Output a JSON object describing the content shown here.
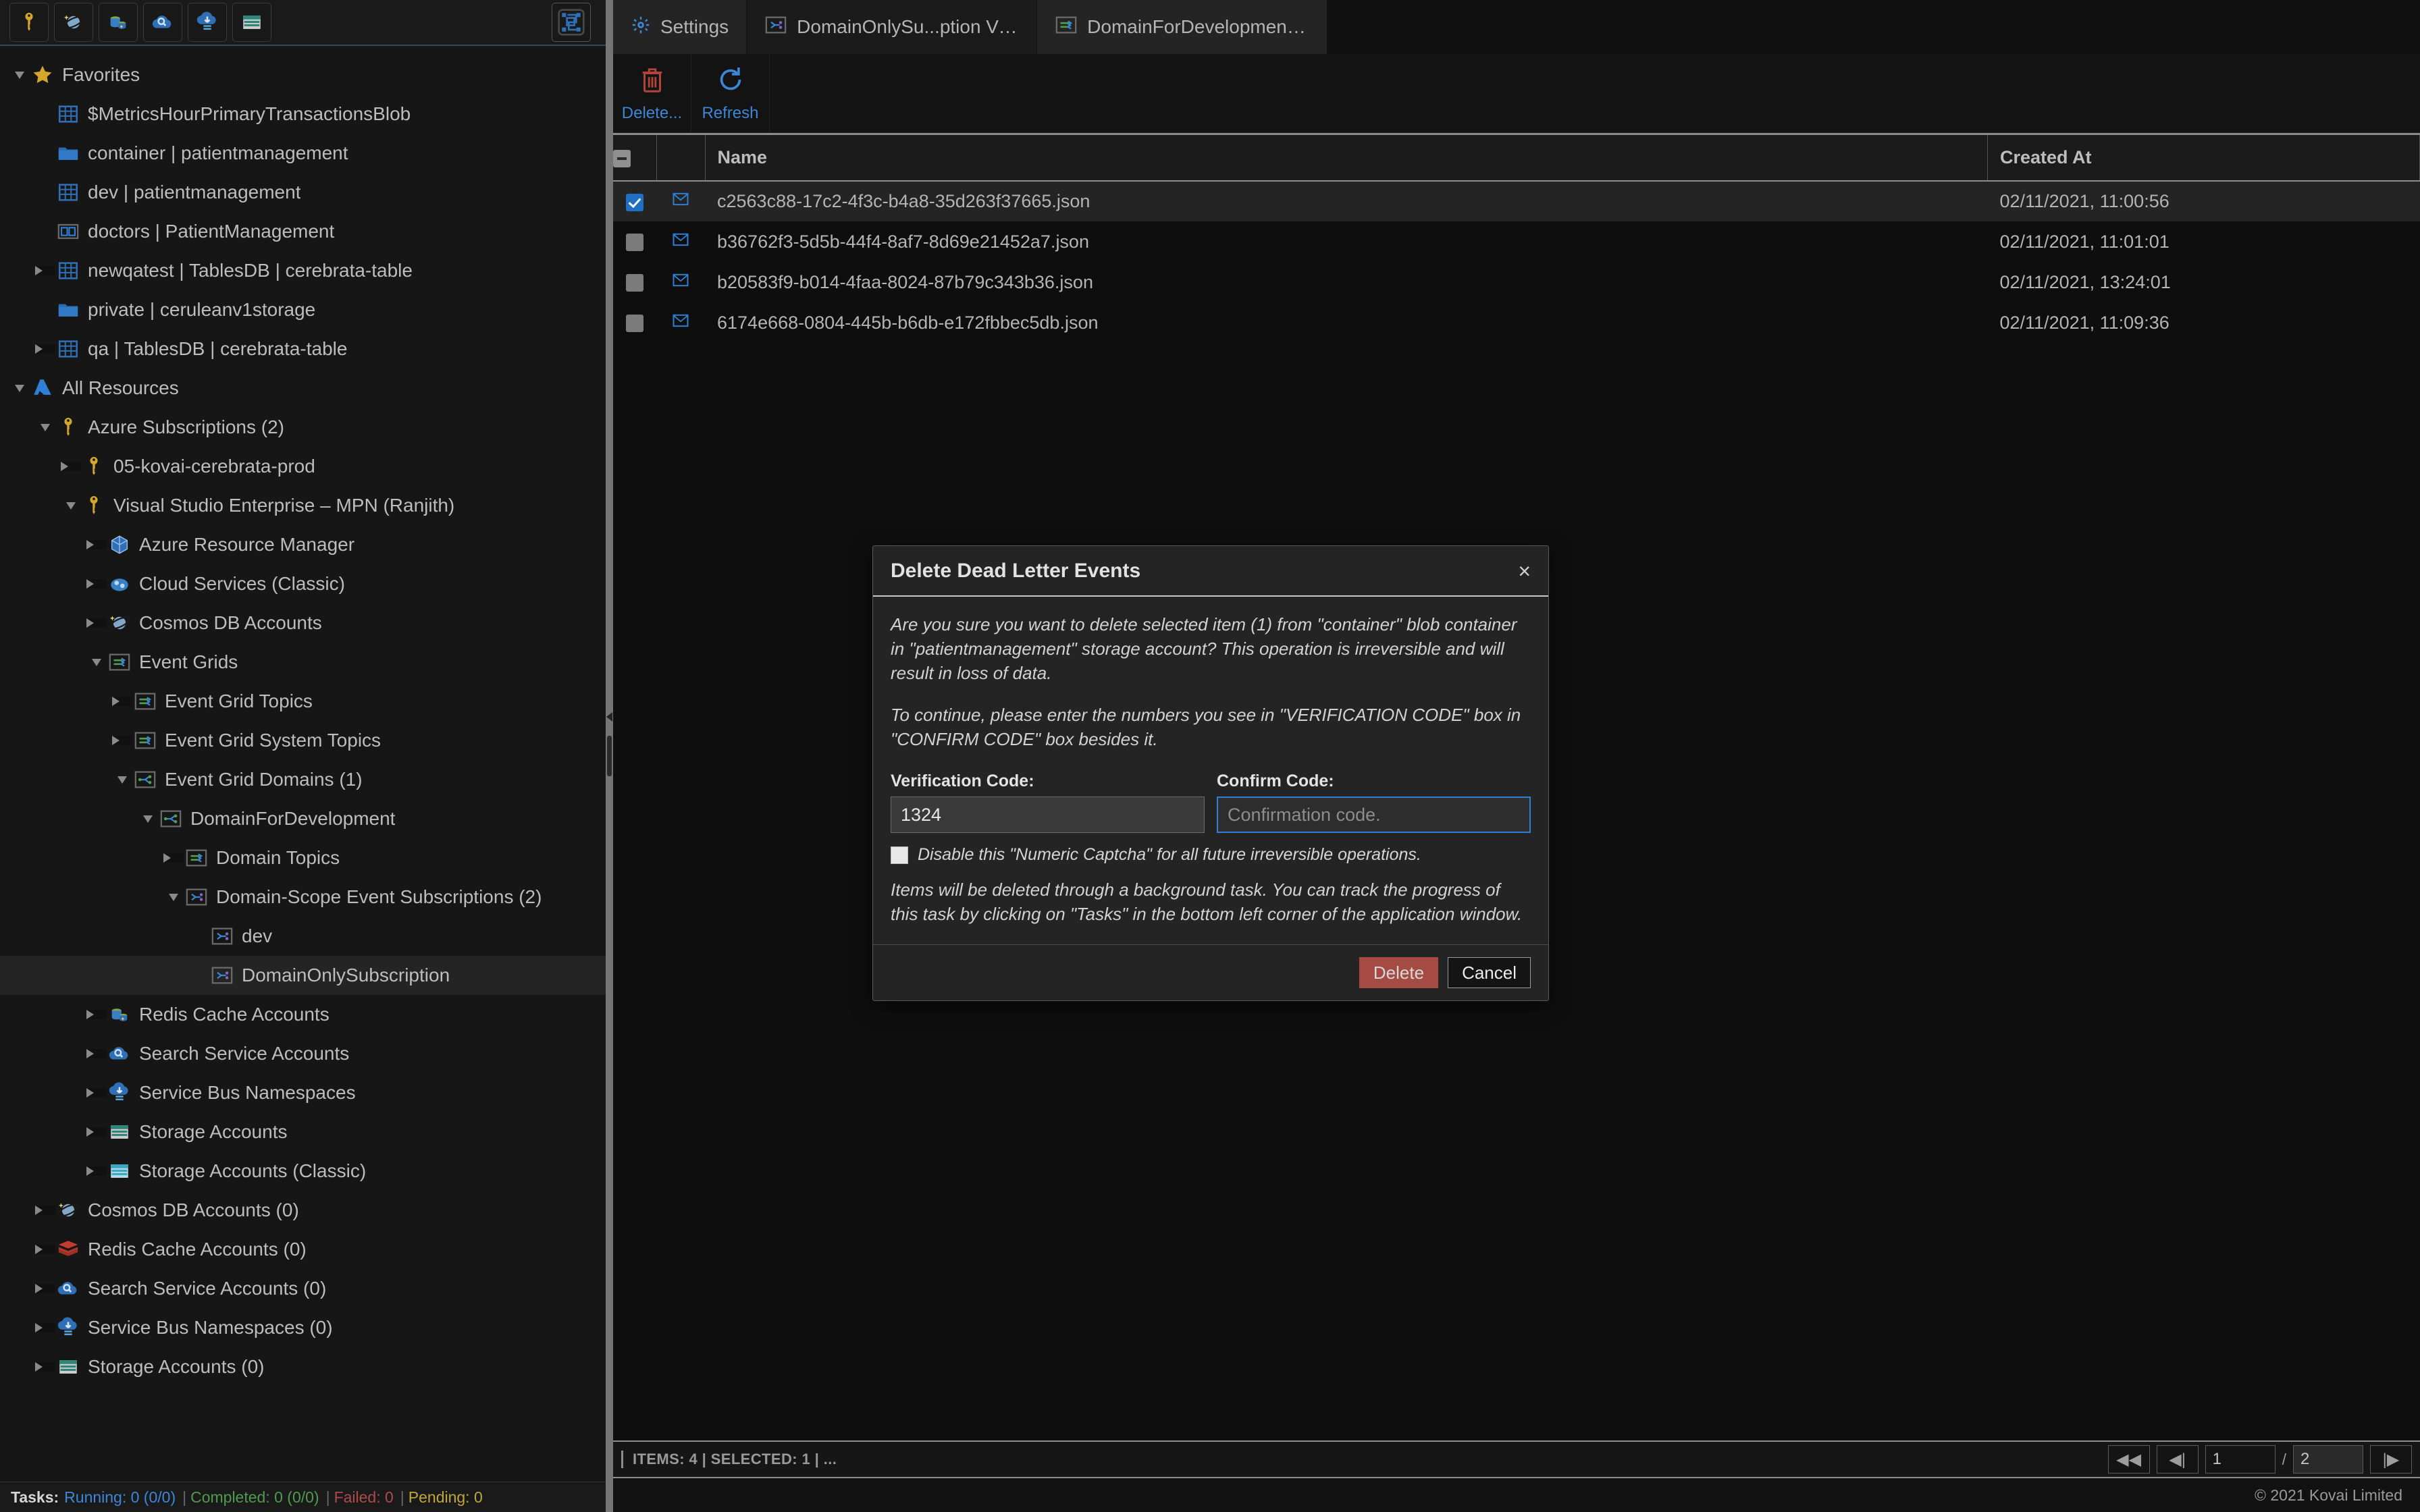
{
  "left_toolbar": {
    "icons": [
      {
        "name": "key-icon",
        "label": "Azure Subscriptions"
      },
      {
        "name": "cosmos-db-icon",
        "label": "Cosmos DB Accounts"
      },
      {
        "name": "redis-cache-icon",
        "label": "Redis Cache Accounts"
      },
      {
        "name": "search-service-icon",
        "label": "Search Service Accounts"
      },
      {
        "name": "service-bus-icon",
        "label": "Service Bus Namespaces"
      },
      {
        "name": "storage-account-icon",
        "label": "Storage Accounts"
      }
    ],
    "right_icon": {
      "name": "collapse-all-icon",
      "label": "Collapse All"
    }
  },
  "tree": [
    {
      "label": "Favorites",
      "depth": 0,
      "twisty": "down",
      "icon": "star-icon",
      "selected": false
    },
    {
      "label": "$MetricsHourPrimaryTransactionsBlob",
      "depth": 1,
      "twisty": "none",
      "icon": "table-icon",
      "selected": false
    },
    {
      "label": "container | patientmanagement",
      "depth": 1,
      "twisty": "none",
      "icon": "folder-icon",
      "selected": false
    },
    {
      "label": "dev | patientmanagement",
      "depth": 1,
      "twisty": "none",
      "icon": "table-icon",
      "selected": false
    },
    {
      "label": "doctors | PatientManagement",
      "depth": 1,
      "twisty": "none",
      "icon": "queue-icon",
      "selected": false
    },
    {
      "label": "newqatest | TablesDB | cerebrata-table",
      "depth": 1,
      "twisty": "right",
      "icon": "table-icon",
      "selected": false
    },
    {
      "label": "private | ceruleanv1storage",
      "depth": 1,
      "twisty": "none",
      "icon": "folder-icon",
      "selected": false
    },
    {
      "label": "qa | TablesDB | cerebrata-table",
      "depth": 1,
      "twisty": "right",
      "icon": "table-icon",
      "selected": false
    },
    {
      "label": "All Resources",
      "depth": 0,
      "twisty": "down",
      "icon": "azure-icon",
      "selected": false
    },
    {
      "label": "Azure Subscriptions (2)",
      "depth": 1,
      "twisty": "down",
      "icon": "key-icon",
      "selected": false
    },
    {
      "label": "05-kovai-cerebrata-prod",
      "depth": 2,
      "twisty": "right",
      "icon": "key-icon",
      "selected": false
    },
    {
      "label": "Visual Studio Enterprise – MPN (Ranjith)",
      "depth": 2,
      "twisty": "down",
      "icon": "key-icon",
      "selected": false
    },
    {
      "label": "Azure Resource Manager",
      "depth": 3,
      "twisty": "right",
      "icon": "resource-manager-icon",
      "selected": false
    },
    {
      "label": "Cloud Services (Classic)",
      "depth": 3,
      "twisty": "right",
      "icon": "cloud-services-icon",
      "selected": false
    },
    {
      "label": "Cosmos DB Accounts",
      "depth": 3,
      "twisty": "right",
      "icon": "cosmos-db-icon",
      "selected": false
    },
    {
      "label": "Event Grids",
      "depth": 3,
      "twisty": "down",
      "icon": "event-grid-icon",
      "selected": false
    },
    {
      "label": "Event Grid Topics",
      "depth": 4,
      "twisty": "right",
      "icon": "event-grid-icon",
      "selected": false
    },
    {
      "label": "Event Grid System Topics",
      "depth": 4,
      "twisty": "right",
      "icon": "event-grid-icon",
      "selected": false
    },
    {
      "label": "Event Grid Domains (1)",
      "depth": 4,
      "twisty": "down",
      "icon": "event-grid-domain-icon",
      "selected": false
    },
    {
      "label": "DomainForDevelopment",
      "depth": 5,
      "twisty": "down",
      "icon": "event-grid-domain-icon",
      "selected": false
    },
    {
      "label": "Domain Topics",
      "depth": 6,
      "twisty": "right",
      "icon": "event-grid-icon",
      "selected": false
    },
    {
      "label": "Domain-Scope Event Subscriptions (2)",
      "depth": 6,
      "twisty": "down",
      "icon": "event-subscription-icon",
      "selected": false
    },
    {
      "label": "dev",
      "depth": 7,
      "twisty": "none",
      "icon": "event-subscription-icon",
      "selected": false
    },
    {
      "label": "DomainOnlySubscription",
      "depth": 7,
      "twisty": "none",
      "icon": "event-subscription-icon",
      "selected": true
    },
    {
      "label": "Redis Cache Accounts",
      "depth": 3,
      "twisty": "right",
      "icon": "redis-cache-icon",
      "selected": false
    },
    {
      "label": "Search Service Accounts",
      "depth": 3,
      "twisty": "right",
      "icon": "search-service-icon",
      "selected": false
    },
    {
      "label": "Service Bus Namespaces",
      "depth": 3,
      "twisty": "right",
      "icon": "service-bus-icon",
      "selected": false
    },
    {
      "label": "Storage Accounts",
      "depth": 3,
      "twisty": "right",
      "icon": "storage-account-icon",
      "selected": false
    },
    {
      "label": "Storage Accounts (Classic)",
      "depth": 3,
      "twisty": "right",
      "icon": "storage-classic-icon",
      "selected": false
    },
    {
      "label": "Cosmos DB Accounts (0)",
      "depth": 1,
      "twisty": "right",
      "icon": "cosmos-db-icon",
      "selected": false
    },
    {
      "label": "Redis Cache Accounts (0)",
      "depth": 1,
      "twisty": "right",
      "icon": "redis-stack-icon",
      "selected": false
    },
    {
      "label": "Search Service Accounts (0)",
      "depth": 1,
      "twisty": "right",
      "icon": "search-service-icon",
      "selected": false
    },
    {
      "label": "Service Bus Namespaces (0)",
      "depth": 1,
      "twisty": "right",
      "icon": "service-bus-icon",
      "selected": false
    },
    {
      "label": "Storage Accounts (0)",
      "depth": 1,
      "twisty": "right",
      "icon": "storage-account-icon",
      "selected": false
    }
  ],
  "tasks": {
    "prefix": "Tasks:",
    "running_label": "Running: 0 (0/0)",
    "completed_label": "Completed: 0 (0/0)",
    "failed_label": "Failed: 0",
    "pending_label": "Pending: 0",
    "separator": "|"
  },
  "tabs": [
    {
      "label": "Settings",
      "icon": "gear-icon",
      "active": false
    },
    {
      "label": "DomainOnlySu...ption Visu",
      "icon": "event-subscription-icon",
      "active": true
    },
    {
      "label": "DomainForDevelopment Vi",
      "icon": "event-grid-icon",
      "active": false
    }
  ],
  "commands": [
    {
      "label": "Delete...",
      "icon": "trash-icon"
    },
    {
      "label": "Refresh",
      "icon": "refresh-icon"
    }
  ],
  "grid": {
    "columns": [
      "",
      "",
      "Name",
      "Created At"
    ],
    "rows": [
      {
        "checked": true,
        "name": "c2563c88-17c2-4f3c-b4a8-35d263f37665.json",
        "created_at": "02/11/2021, 11:00:56"
      },
      {
        "checked": false,
        "name": "b36762f3-5d5b-44f4-8af7-8d69e21452a7.json",
        "created_at": "02/11/2021, 11:01:01"
      },
      {
        "checked": false,
        "name": "b20583f9-b014-4faa-8024-87b79c343b36.json",
        "created_at": "02/11/2021, 13:24:01"
      },
      {
        "checked": false,
        "name": "6174e668-0804-445b-b6db-e172fbbec5db.json",
        "created_at": "02/11/2021, 11:09:36"
      }
    ]
  },
  "statusbar": {
    "summary": "ITEMS: 4 | SELECTED: 1 |  ...",
    "pager": {
      "first_label": "◀◀",
      "prev_label": "◀|",
      "page": "1",
      "slash": "/",
      "total_pages": "2",
      "last_label": "|▶"
    }
  },
  "copyright": "© 2021 Kovai Limited",
  "dialog": {
    "title": "Delete Dead Letter Events",
    "close_label": "×",
    "paragraph1": "Are you sure you want to delete selected item (1) from \"container\" blob container in \"patientmanagement\" storage account? This operation is irreversible and will result in loss of data.",
    "paragraph2": "To continue, please enter the numbers you see in \"VERIFICATION CODE\" box in \"CONFIRM CODE\" box besides it.",
    "verification_label": "Verification Code:",
    "verification_value": "1324",
    "confirm_label": "Confirm Code:",
    "confirm_placeholder": "Confirmation code.",
    "confirm_value": "",
    "checkbox_label": "Disable this \"Numeric Captcha\" for all future irreversible operations.",
    "checkbox_checked": false,
    "paragraph3": "Items will be deleted through a background task. You can track the progress of this task by clicking on \"Tasks\" in the bottom left corner of the application window.",
    "delete_label": "Delete",
    "cancel_label": "Cancel"
  },
  "colors": {
    "accent_blue": "#3d87d8",
    "delete_red": "#a54b44",
    "selection_blue": "#1f6fc4",
    "running": "#3d87d8",
    "completed": "#4f9b4f",
    "failed": "#b04a4a",
    "pending": "#c0a63a"
  }
}
